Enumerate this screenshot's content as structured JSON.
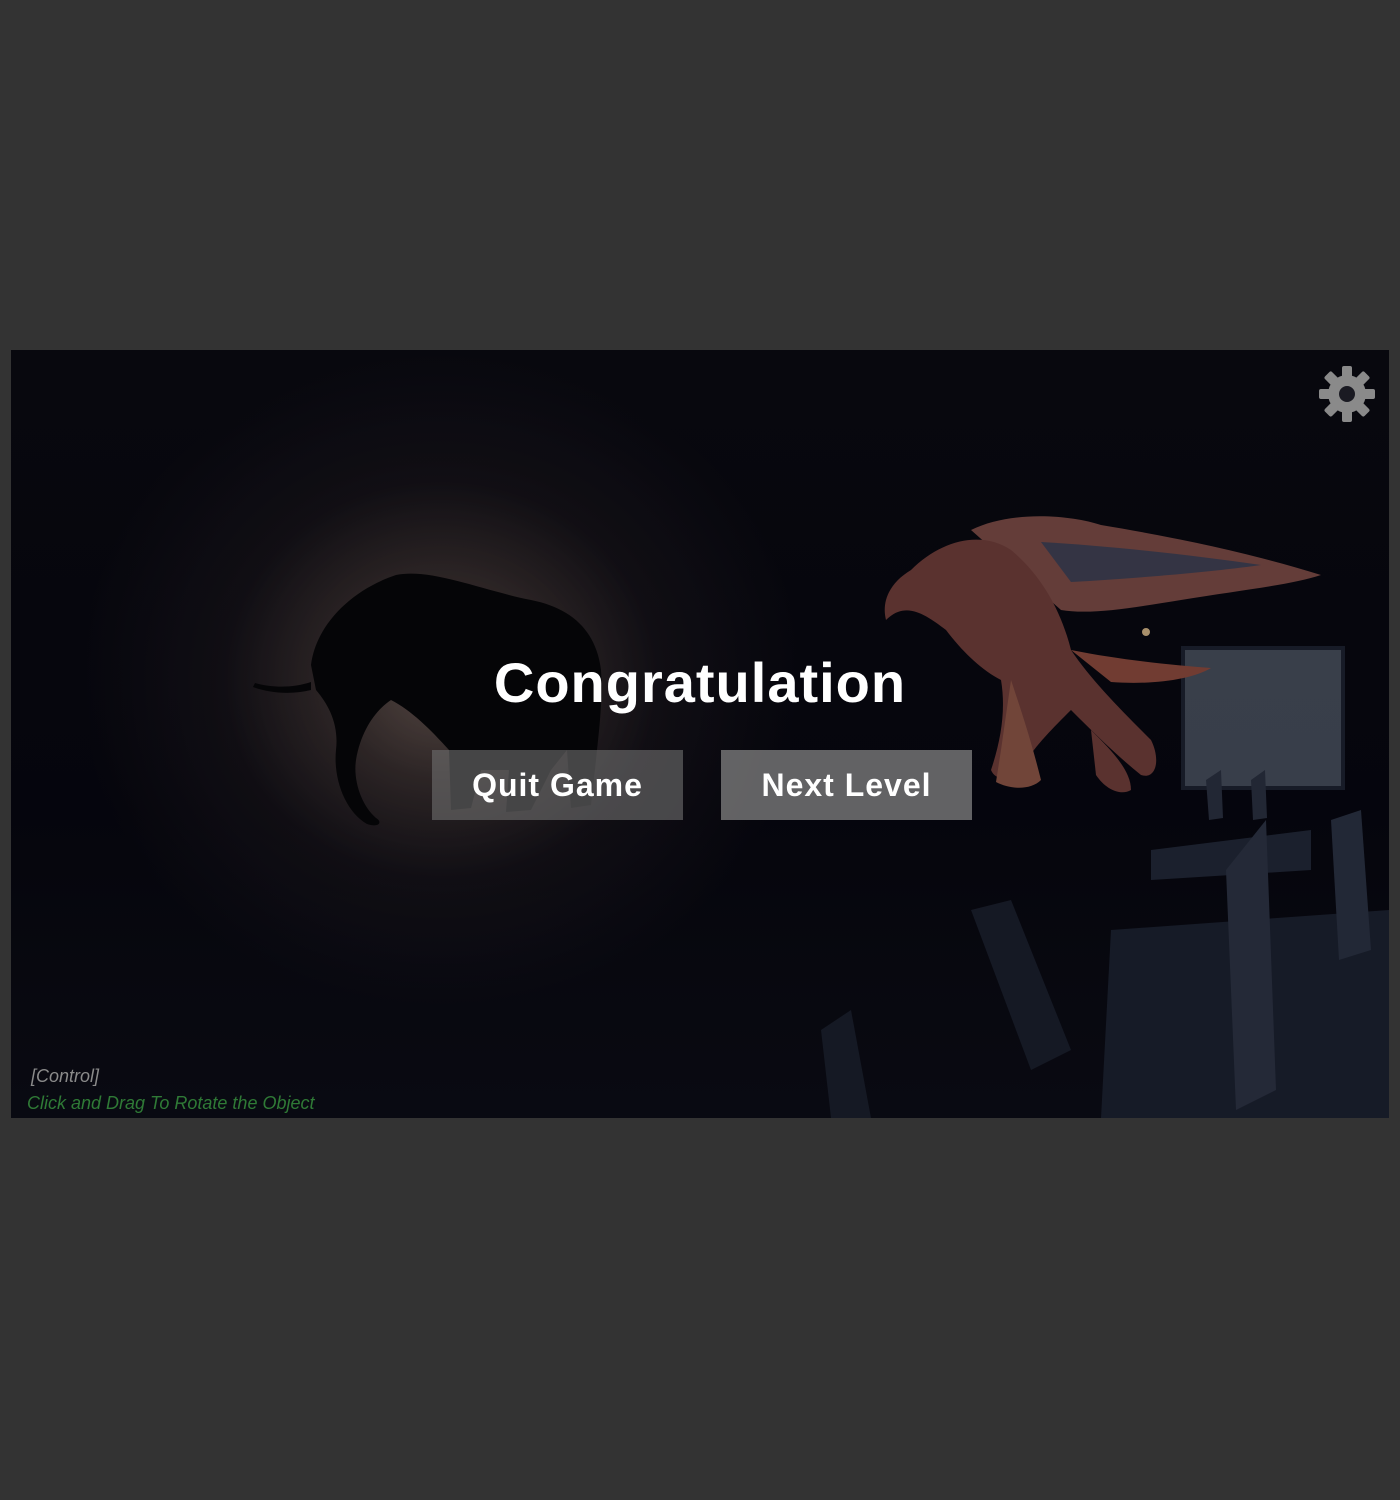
{
  "game": {
    "title": "Congratulation",
    "buttons": {
      "quit_label": "Quit Game",
      "next_label": "Next Level"
    },
    "controls": {
      "label": "[Control]",
      "hint": "Click and Drag To Rotate the Object"
    }
  },
  "icons": {
    "settings": "gear-icon"
  },
  "colors": {
    "page_bg": "#333333",
    "button_bg": "#8a8a8a",
    "title_text": "#ffffff",
    "hint_text": "#2f7a36"
  }
}
